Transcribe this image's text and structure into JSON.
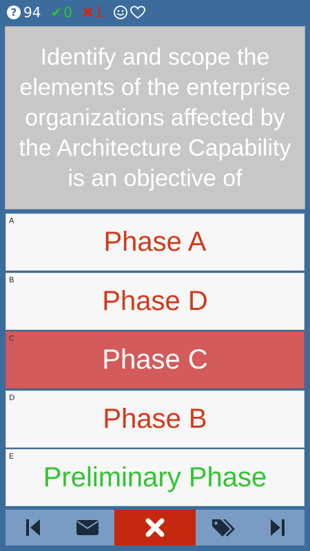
{
  "status": {
    "question_count": "94",
    "correct_count": "0",
    "wrong_count": "1",
    "icons": [
      "question-icon",
      "check-icon",
      "cross-icon",
      "smiley-icon",
      "heart-icon"
    ]
  },
  "question": {
    "text": "Identify and scope the elements of the enterprise organizations affected by the Architecture Capability is an objective of"
  },
  "answers": [
    {
      "letter": "A",
      "text": "Phase A",
      "state": "normal"
    },
    {
      "letter": "B",
      "text": "Phase D",
      "state": "normal"
    },
    {
      "letter": "C",
      "text": "Phase C",
      "state": "selected-wrong"
    },
    {
      "letter": "D",
      "text": "Phase B",
      "state": "normal"
    },
    {
      "letter": "E",
      "text": "Preliminary Phase",
      "state": "correct"
    }
  ],
  "toolbar": {
    "icons": [
      "skip-previous-icon",
      "envelope-icon",
      "close-icon",
      "tags-icon",
      "skip-next-icon"
    ]
  },
  "colors": {
    "background": "#3c6c9c",
    "question_bg": "#c7c7c7",
    "answer_text": "#d2391a",
    "correct_text": "#2fc52f",
    "wrong_bg": "#d45b5b",
    "toolbar_bg": "#7a9cc4",
    "active_button": "#c4290f"
  }
}
